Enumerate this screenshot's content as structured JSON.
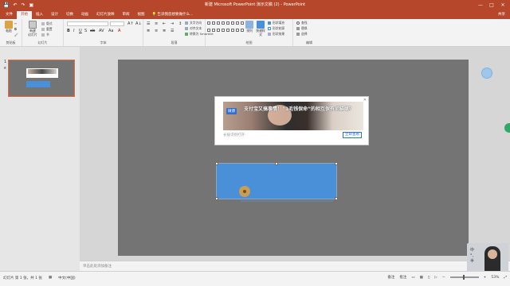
{
  "window": {
    "title": "新建 Microsoft PowerPoint 演示文稿 (2) - PowerPoint",
    "qat": [
      "save-icon",
      "undo-icon",
      "redo-icon",
      "start-icon"
    ],
    "controls": [
      "—",
      "□",
      "✕"
    ]
  },
  "tabs": {
    "items": [
      "文件",
      "开始",
      "插入",
      "设计",
      "切换",
      "动画",
      "幻灯片放映",
      "审阅",
      "视图"
    ],
    "active_index": 1,
    "tell_me": "告诉我您想要做什么...",
    "share": "共享"
  },
  "ribbon": {
    "paste_label": "粘贴",
    "new_slide_label": "新建\n幻灯片",
    "layout_label": "版式",
    "reset_label": "重置",
    "section_label": "节",
    "font_group_buttons": [
      "B",
      "I",
      "U",
      "S",
      "ab",
      "AV",
      "Aa",
      "A"
    ],
    "drawing_label": "绘图",
    "arrange_label": "排列",
    "quick_styles_label": "快速样式",
    "shape_fill": "形状填充",
    "shape_outline": "形状轮廓",
    "shape_effects": "形状效果",
    "find_label": "查找",
    "replace_label": "替换",
    "select_label": "选择",
    "groups": [
      "剪贴板",
      "幻灯片",
      "字体",
      "段落",
      "绘图",
      "编辑"
    ],
    "text_direction": "文字方向",
    "align_text": "对齐文本",
    "smartart": "转换为 SmartArt"
  },
  "thumbnails": {
    "items": [
      {
        "number": "1"
      }
    ]
  },
  "slide": {
    "ad": {
      "badge": "微博",
      "headline": "支付宝又搞事情！“1毛钱保命”的相互保有何猫腻？",
      "footer": "长按识别打开",
      "cta": "立即查看",
      "close": "✕"
    }
  },
  "notes": {
    "placeholder": "单击此处添加备注"
  },
  "webcam": {
    "ime": "中\n°,\n半"
  },
  "statusbar": {
    "slide_info": "幻灯片 第 1 张，共 1 张",
    "language": "中文(中国)",
    "notes_btn": "备注",
    "comments_btn": "批注",
    "zoom": "53%"
  },
  "colors": {
    "accent": "#b7472a",
    "blue_box": "#4a90d9"
  }
}
